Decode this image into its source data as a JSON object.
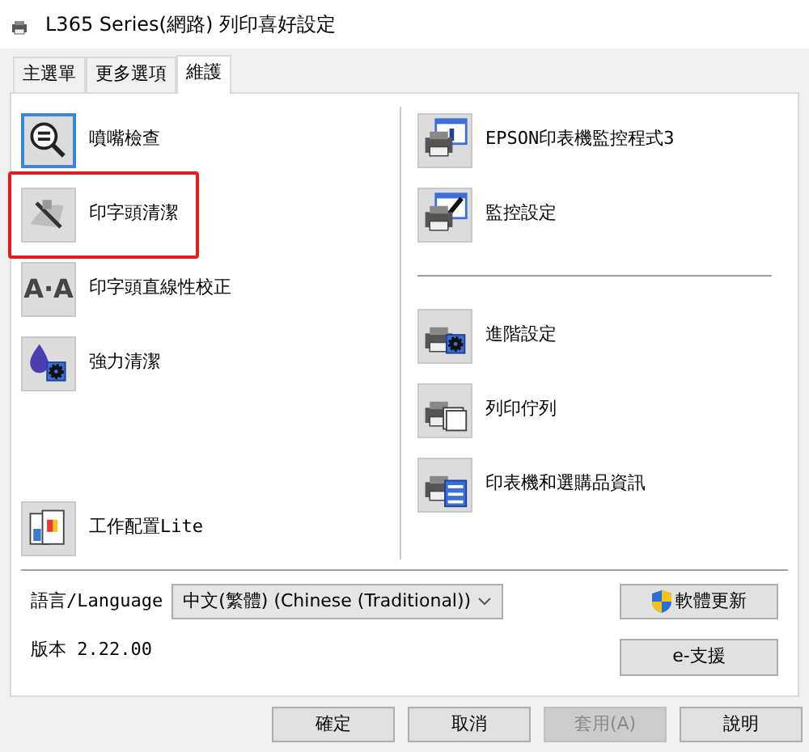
{
  "window": {
    "title": "L365 Series(網路) 列印喜好設定"
  },
  "tabs": [
    {
      "label": "主選單",
      "selected": false
    },
    {
      "label": "更多選項",
      "selected": false
    },
    {
      "label": "維護",
      "selected": true
    }
  ],
  "left_tools": [
    {
      "label": "噴嘴檢查",
      "kind": "magnifier",
      "focused": true,
      "highlighted": false
    },
    {
      "label": "印字頭清潔",
      "kind": "brush",
      "focused": false,
      "highlighted": true
    },
    {
      "label": "印字頭直線性校正",
      "kind": "text",
      "icon_text": "A·A",
      "focused": false,
      "highlighted": false
    },
    {
      "label": "強力清潔",
      "kind": "ink-gear",
      "focused": false,
      "highlighted": false
    },
    {
      "label": "工作配置Lite",
      "kind": "documents",
      "focused": false,
      "highlighted": false
    }
  ],
  "right_groups": [
    [
      {
        "label": "EPSON印表機監控程式3",
        "kind": "printer-info",
        "focused": false,
        "highlighted": false
      },
      {
        "label": "監控設定",
        "kind": "printer-check",
        "focused": false,
        "highlighted": false
      }
    ],
    [
      {
        "label": "進階設定",
        "kind": "printer-gear",
        "focused": false,
        "highlighted": false
      },
      {
        "label": "列印佇列",
        "kind": "printer-queue",
        "focused": false,
        "highlighted": false
      },
      {
        "label": "印表機和選購品資訊",
        "kind": "printer-list",
        "focused": false,
        "highlighted": false
      }
    ]
  ],
  "language": {
    "label": "語言/Language",
    "value": "中文(繁體) (Chinese (Traditional))"
  },
  "update_button": "軟體更新",
  "version": "版本 2.22.00",
  "support_button": "e-支援",
  "buttons": [
    {
      "label": "確定",
      "disabled": false
    },
    {
      "label": "取消",
      "disabled": false
    },
    {
      "label": "套用(A)",
      "disabled": true
    },
    {
      "label": "說明",
      "disabled": false
    }
  ]
}
